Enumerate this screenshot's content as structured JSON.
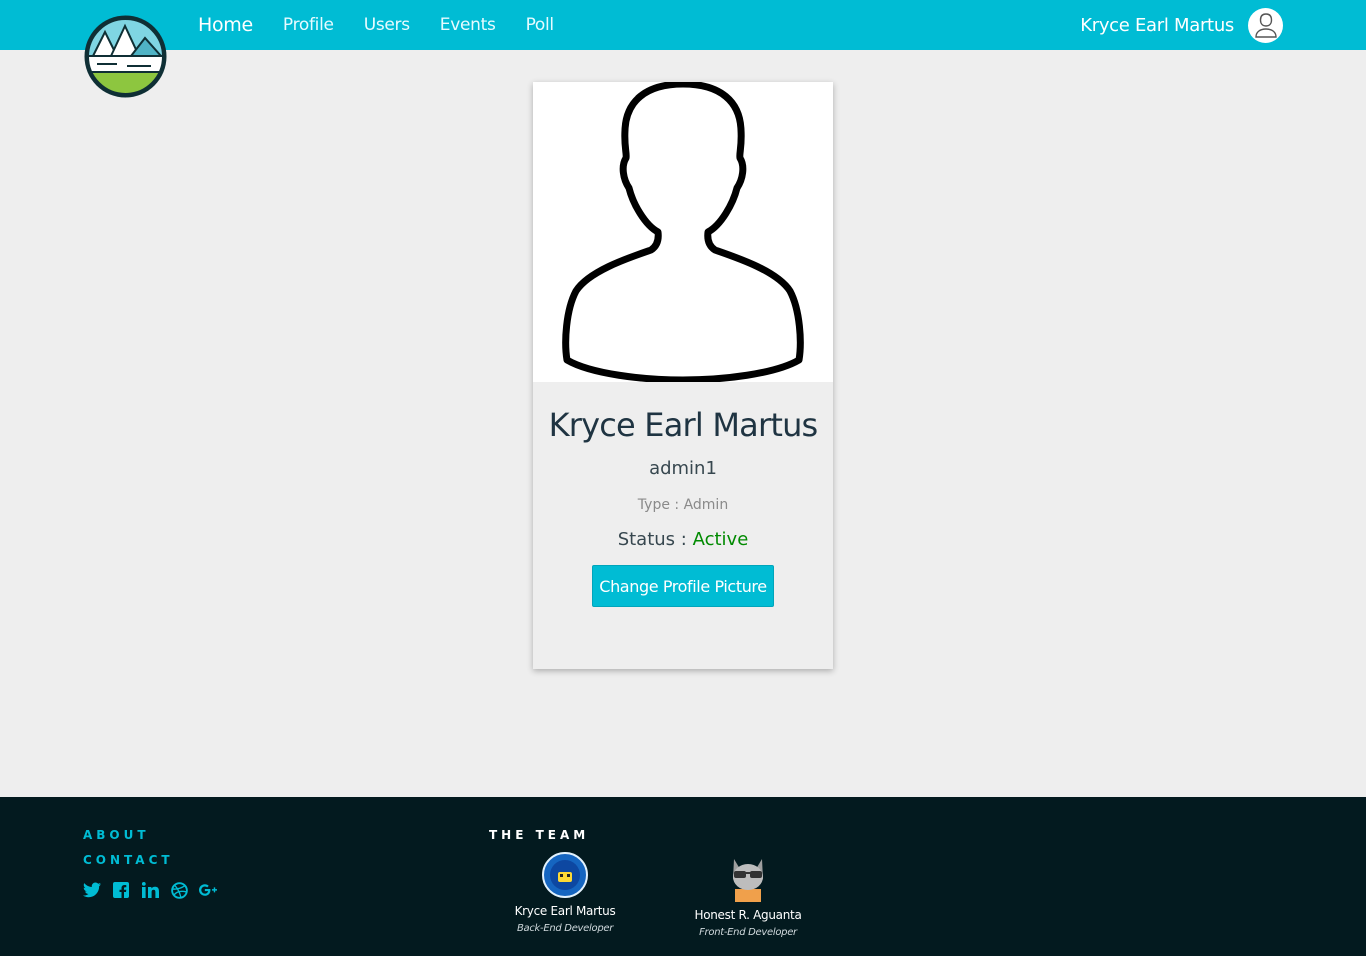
{
  "nav": {
    "links": [
      "Home",
      "Profile",
      "Users",
      "Events",
      "Poll"
    ],
    "user_name": "Kryce Earl Martus"
  },
  "profile": {
    "name": "Kryce Earl Martus",
    "username": "admin1",
    "type_label": "Type : Admin",
    "status_label": "Status :",
    "status_value": "Active",
    "button_label": "Change Profile Picture"
  },
  "footer": {
    "about": "ABOUT",
    "contact": "CONTACT",
    "socials": [
      "twitter-icon",
      "facebook-icon",
      "linkedin-icon",
      "dribbble-icon",
      "google-plus-icon"
    ],
    "team_title": "THE TEAM",
    "team": [
      {
        "name": "Kryce Earl Martus",
        "role": "Back-End Developer"
      },
      {
        "name": "Honest R. Aguanta",
        "role": "Front-End Developer"
      }
    ]
  },
  "colors": {
    "primary": "#00bcd4",
    "status_active": "#008a00",
    "footer_bg": "#031a1f",
    "page_bg": "#eeeeee"
  }
}
